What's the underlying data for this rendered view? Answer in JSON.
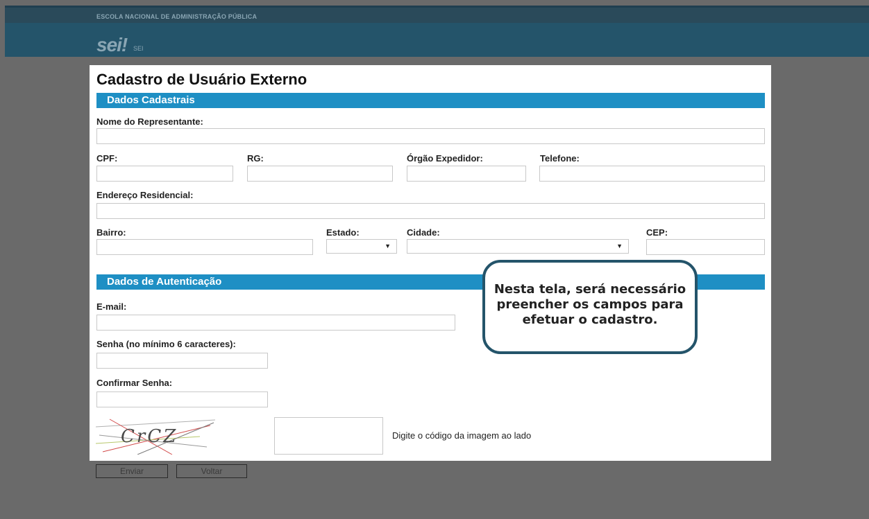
{
  "header": {
    "org_name": "ESCOLA NACIONAL DE ADMINISTRAÇÃO PÚBLICA",
    "logo": "sei!",
    "logo_sub": "SEI"
  },
  "page_title": "Cadastro de Usuário Externo",
  "sections": {
    "dados_cadastrais": "Dados Cadastrais",
    "dados_autenticacao": "Dados de Autenticação"
  },
  "fields": {
    "nome": {
      "label": "Nome do Representante:",
      "value": ""
    },
    "cpf": {
      "label": "CPF:",
      "value": ""
    },
    "rg": {
      "label": "RG:",
      "value": ""
    },
    "orgao": {
      "label": "Órgão Expedidor:",
      "value": ""
    },
    "telefone": {
      "label": "Telefone:",
      "value": ""
    },
    "endereco": {
      "label": "Endereço Residencial:",
      "value": ""
    },
    "bairro": {
      "label": "Bairro:",
      "value": ""
    },
    "estado": {
      "label": "Estado:",
      "selected": ""
    },
    "cidade": {
      "label": "Cidade:",
      "selected": ""
    },
    "cep": {
      "label": "CEP:",
      "value": ""
    },
    "email": {
      "label": "E-mail:",
      "value": ""
    },
    "senha": {
      "label": "Senha (no mínimo 6 caracteres):",
      "value": ""
    },
    "confirmar_senha": {
      "label": "Confirmar Senha:",
      "value": ""
    }
  },
  "captcha": {
    "code": "CrCZ",
    "hint": "Digite o código da imagem ao lado"
  },
  "buttons": {
    "enviar": "Enviar",
    "voltar": "Voltar"
  },
  "callout": {
    "line1": "Nesta tela, será necessário",
    "line2": "preencher os campos para",
    "line3": "efetuar o cadastro."
  },
  "colors": {
    "header": "#24546a",
    "section_bar": "#1e8fc4",
    "background": "#6a6a6a"
  }
}
